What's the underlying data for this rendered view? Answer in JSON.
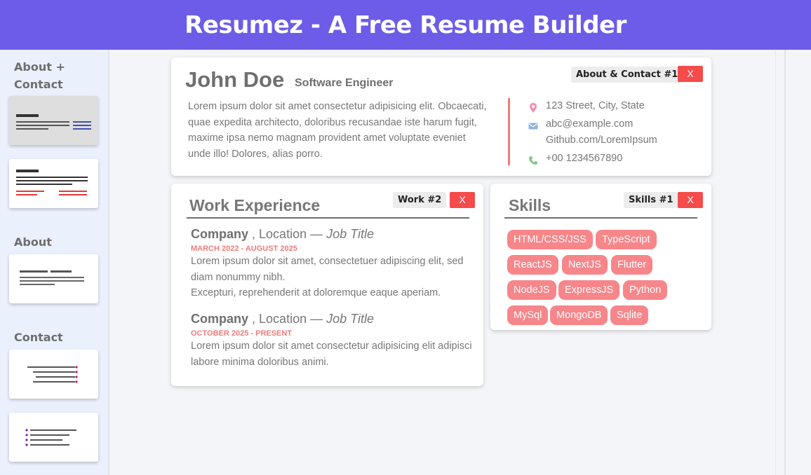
{
  "app": {
    "title": "Resumez - A Free Resume Builder"
  },
  "colors": {
    "header": "#6c5ce7",
    "accent": "#f07b7b",
    "danger": "#f54b4b",
    "chip": "#f7868a"
  },
  "sidebar": {
    "sections": [
      {
        "title": "About + Contact"
      },
      {
        "title": "About"
      },
      {
        "title": "Contact"
      }
    ]
  },
  "about_contact": {
    "tag": "About & Contact #1",
    "remove_label": "X",
    "name": "John Doe",
    "role": "Software Engineer",
    "about": "Lorem ipsum dolor sit amet consectetur adipisicing elit. Obcaecati, quae expedita architecto, doloribus recusandae iste harum fugit, maxime ipsa nemo magnam provident amet voluptate eveniet unde illo! Dolores, alias porro.",
    "address": "123 Street, City, State",
    "email": "abc@example.com",
    "github": "Github.com/LoremIpsum",
    "phone": "+00 1234567890",
    "icons": {
      "address": "location-pin-icon",
      "email": "mail-icon",
      "phone": "phone-icon"
    }
  },
  "work": {
    "tag": "Work #2",
    "remove_label": "X",
    "title": "Work Experience",
    "jobs": [
      {
        "company": "Company",
        "location": ", Location —",
        "job_title": "Job Title",
        "dates": "MARCH 2022 - AUGUST 2025",
        "desc1": "Lorem ipsum dolor sit amet, consectetuer adipiscing elit, sed diam nonummy nibh.",
        "desc2": "Excepturi, reprehenderit at doloremque eaque aperiam."
      },
      {
        "company": "Company",
        "location": ", Location —",
        "job_title": "Job Title",
        "dates": "OCTOBER 2025 - PRESENT",
        "desc1": "Lorem ipsum dolor sit amet consectetur adipisicing elit adipisci labore minima doloribus animi."
      }
    ]
  },
  "skills": {
    "tag": "Skills #1",
    "remove_label": "X",
    "title": "Skills",
    "items": [
      "HTML/CSS/JSS",
      "TypeScript",
      "ReactJS",
      "NextJS",
      "Flutter",
      "NodeJS",
      "ExpressJS",
      "Python",
      "MySql",
      "MongoDB",
      "Sqlite"
    ]
  }
}
